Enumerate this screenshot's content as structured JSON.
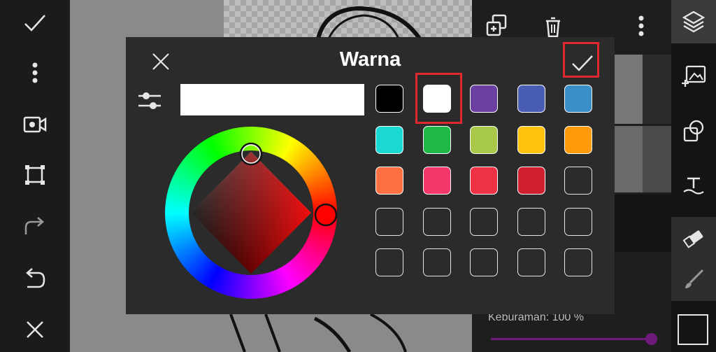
{
  "dialog": {
    "title": "Warna",
    "hex_value": "",
    "selected_color": "#ffffff",
    "wheel_hue_color": "#ff0000",
    "swatches": [
      "#000000",
      "#ffffff",
      "#6b3fa0",
      "#4a5db5",
      "#3a8fc8",
      "#1ad8d2",
      "#1fb847",
      "#a8c84a",
      "#ffc20e",
      "#ff9a0a",
      "#ff7043",
      "#f5386b",
      "#ee3145",
      "#d0202f",
      "",
      "",
      "",
      "",
      "",
      "",
      "",
      "",
      "",
      "",
      ""
    ]
  },
  "layers_panel": {
    "opacity_label": "Keburaman: 100 %",
    "accent_color": "#6d1b7b"
  },
  "icons": {
    "left": [
      "check-icon",
      "more-vertical-icon",
      "camera-icon",
      "crop-icon",
      "redo-icon",
      "undo-icon",
      "close-icon"
    ],
    "layers_header": [
      "add-layer-icon",
      "delete-icon",
      "more-vertical-icon"
    ],
    "right": [
      "layers-icon",
      "add-image-icon",
      "shapes-icon",
      "text-icon",
      "eraser-icon",
      "brush-icon",
      "color-icon"
    ]
  }
}
